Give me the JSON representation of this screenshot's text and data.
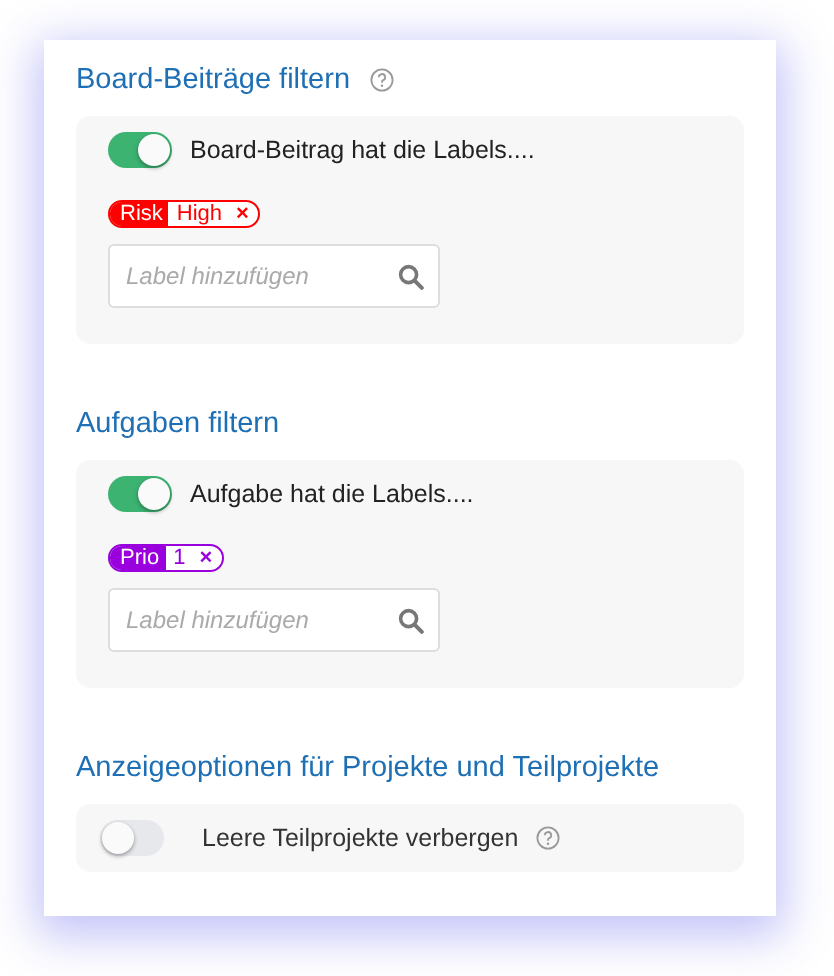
{
  "sections": [
    {
      "title": "Board-Beiträge filtern",
      "help": true,
      "toggle": {
        "on": true,
        "label": "Board-Beitrag hat die Labels....",
        "help": false
      },
      "tags": [
        {
          "name": "Risk",
          "value": "High",
          "remove": "×",
          "color": "#ff0000"
        }
      ],
      "field": {
        "placeholder": "Label hinzufügen"
      }
    },
    {
      "title": "Aufgaben filtern",
      "help": false,
      "toggle": {
        "on": true,
        "label": "Aufgabe hat die Labels....",
        "help": false
      },
      "tags": [
        {
          "name": "Prio",
          "value": "1",
          "remove": "×",
          "color": "#9900dd"
        }
      ],
      "field": {
        "placeholder": "Label hinzufügen"
      }
    },
    {
      "title": "Anzeigeoptionen für Projekte und Teilprojekte",
      "help": false,
      "toggle": {
        "on": false,
        "label": "Leere Teilprojekte verbergen",
        "help": true
      }
    }
  ]
}
